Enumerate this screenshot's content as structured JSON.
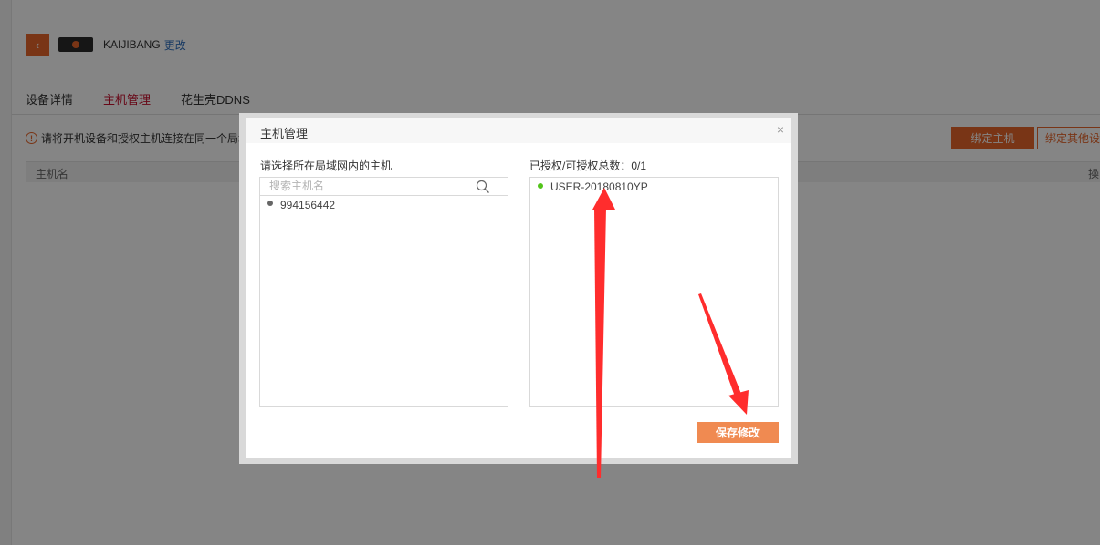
{
  "header": {
    "back_icon": "chevron-left-icon",
    "device_name": "KAIJIBANG",
    "rename_link": "更改"
  },
  "tabs": [
    {
      "label": "设备详情",
      "active": false
    },
    {
      "label": "主机管理",
      "active": true
    },
    {
      "label": "花生壳DDNS",
      "active": false
    }
  ],
  "notice": {
    "text": "请将开机设备和授权主机连接在同一个局域"
  },
  "toolbar": {
    "bind_host_label": "绑定主机",
    "bind_other_label": "绑定其他设"
  },
  "table": {
    "columns": [
      "主机名",
      "操"
    ]
  },
  "modal": {
    "title": "主机管理",
    "close_glyph": "×",
    "left_label": "请选择所在局域网内的主机",
    "search_placeholder": "搜索主机名",
    "search_value": "",
    "hosts": [
      {
        "name": "994156442",
        "status_color": "#666666"
      }
    ],
    "right_label": "已授权/可授权总数：0/1",
    "authorized": [
      {
        "name": "USER-20180810YP",
        "status_color": "#52c41a"
      }
    ],
    "save_label": "保存修改"
  },
  "colors": {
    "accent": "#e8662b",
    "active_tab": "#c8102e",
    "link": "#2f6fbe",
    "save_button": "#f08a51",
    "online_dot": "#52c41a",
    "annotation_arrow": "#ff2d2d"
  }
}
